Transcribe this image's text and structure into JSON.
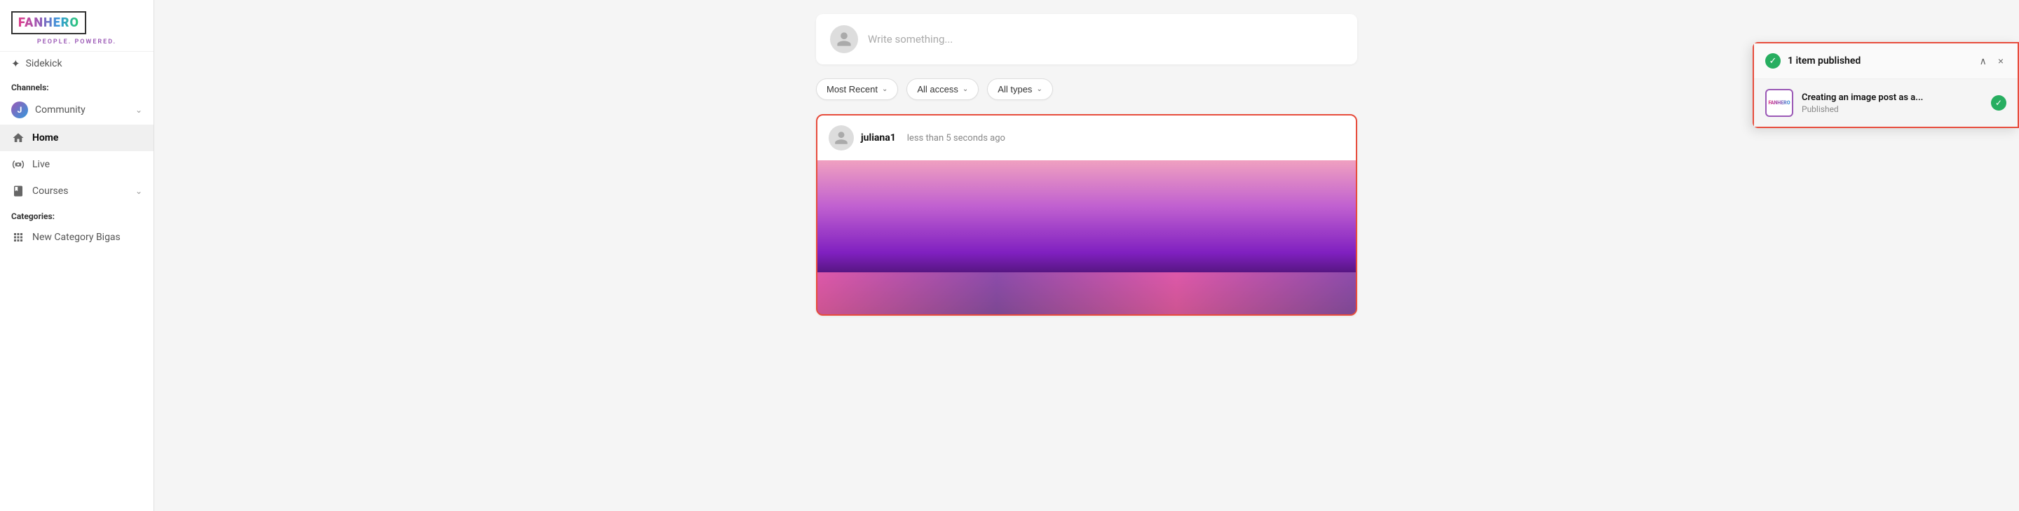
{
  "logo": {
    "text": "FANHERO",
    "tagline": "PEOPLE. POWERED."
  },
  "sidebar": {
    "sidekick_label": "Sidekick",
    "channels_label": "Channels:",
    "categories_label": "Categories:",
    "community": {
      "letter": "J",
      "label": "Community"
    },
    "nav_items": [
      {
        "id": "home",
        "label": "Home",
        "icon": "home",
        "active": true
      },
      {
        "id": "live",
        "label": "Live",
        "icon": "live"
      },
      {
        "id": "courses",
        "label": "Courses",
        "icon": "courses"
      }
    ],
    "categories": [
      {
        "id": "new-category",
        "label": "New Category Bigas",
        "icon": "grid"
      }
    ]
  },
  "main": {
    "write_placeholder": "Write something...",
    "filters": [
      {
        "id": "most-recent",
        "label": "Most Recent"
      },
      {
        "id": "all-access",
        "label": "All access"
      },
      {
        "id": "all-types",
        "label": "All types"
      }
    ],
    "post": {
      "username": "juliana1",
      "time": "less than 5 seconds ago"
    }
  },
  "notification": {
    "title": "1 item published",
    "item": {
      "post_title": "Creating an image post as a...",
      "status": "Published"
    },
    "collapse_icon": "∧",
    "close_icon": "×"
  }
}
